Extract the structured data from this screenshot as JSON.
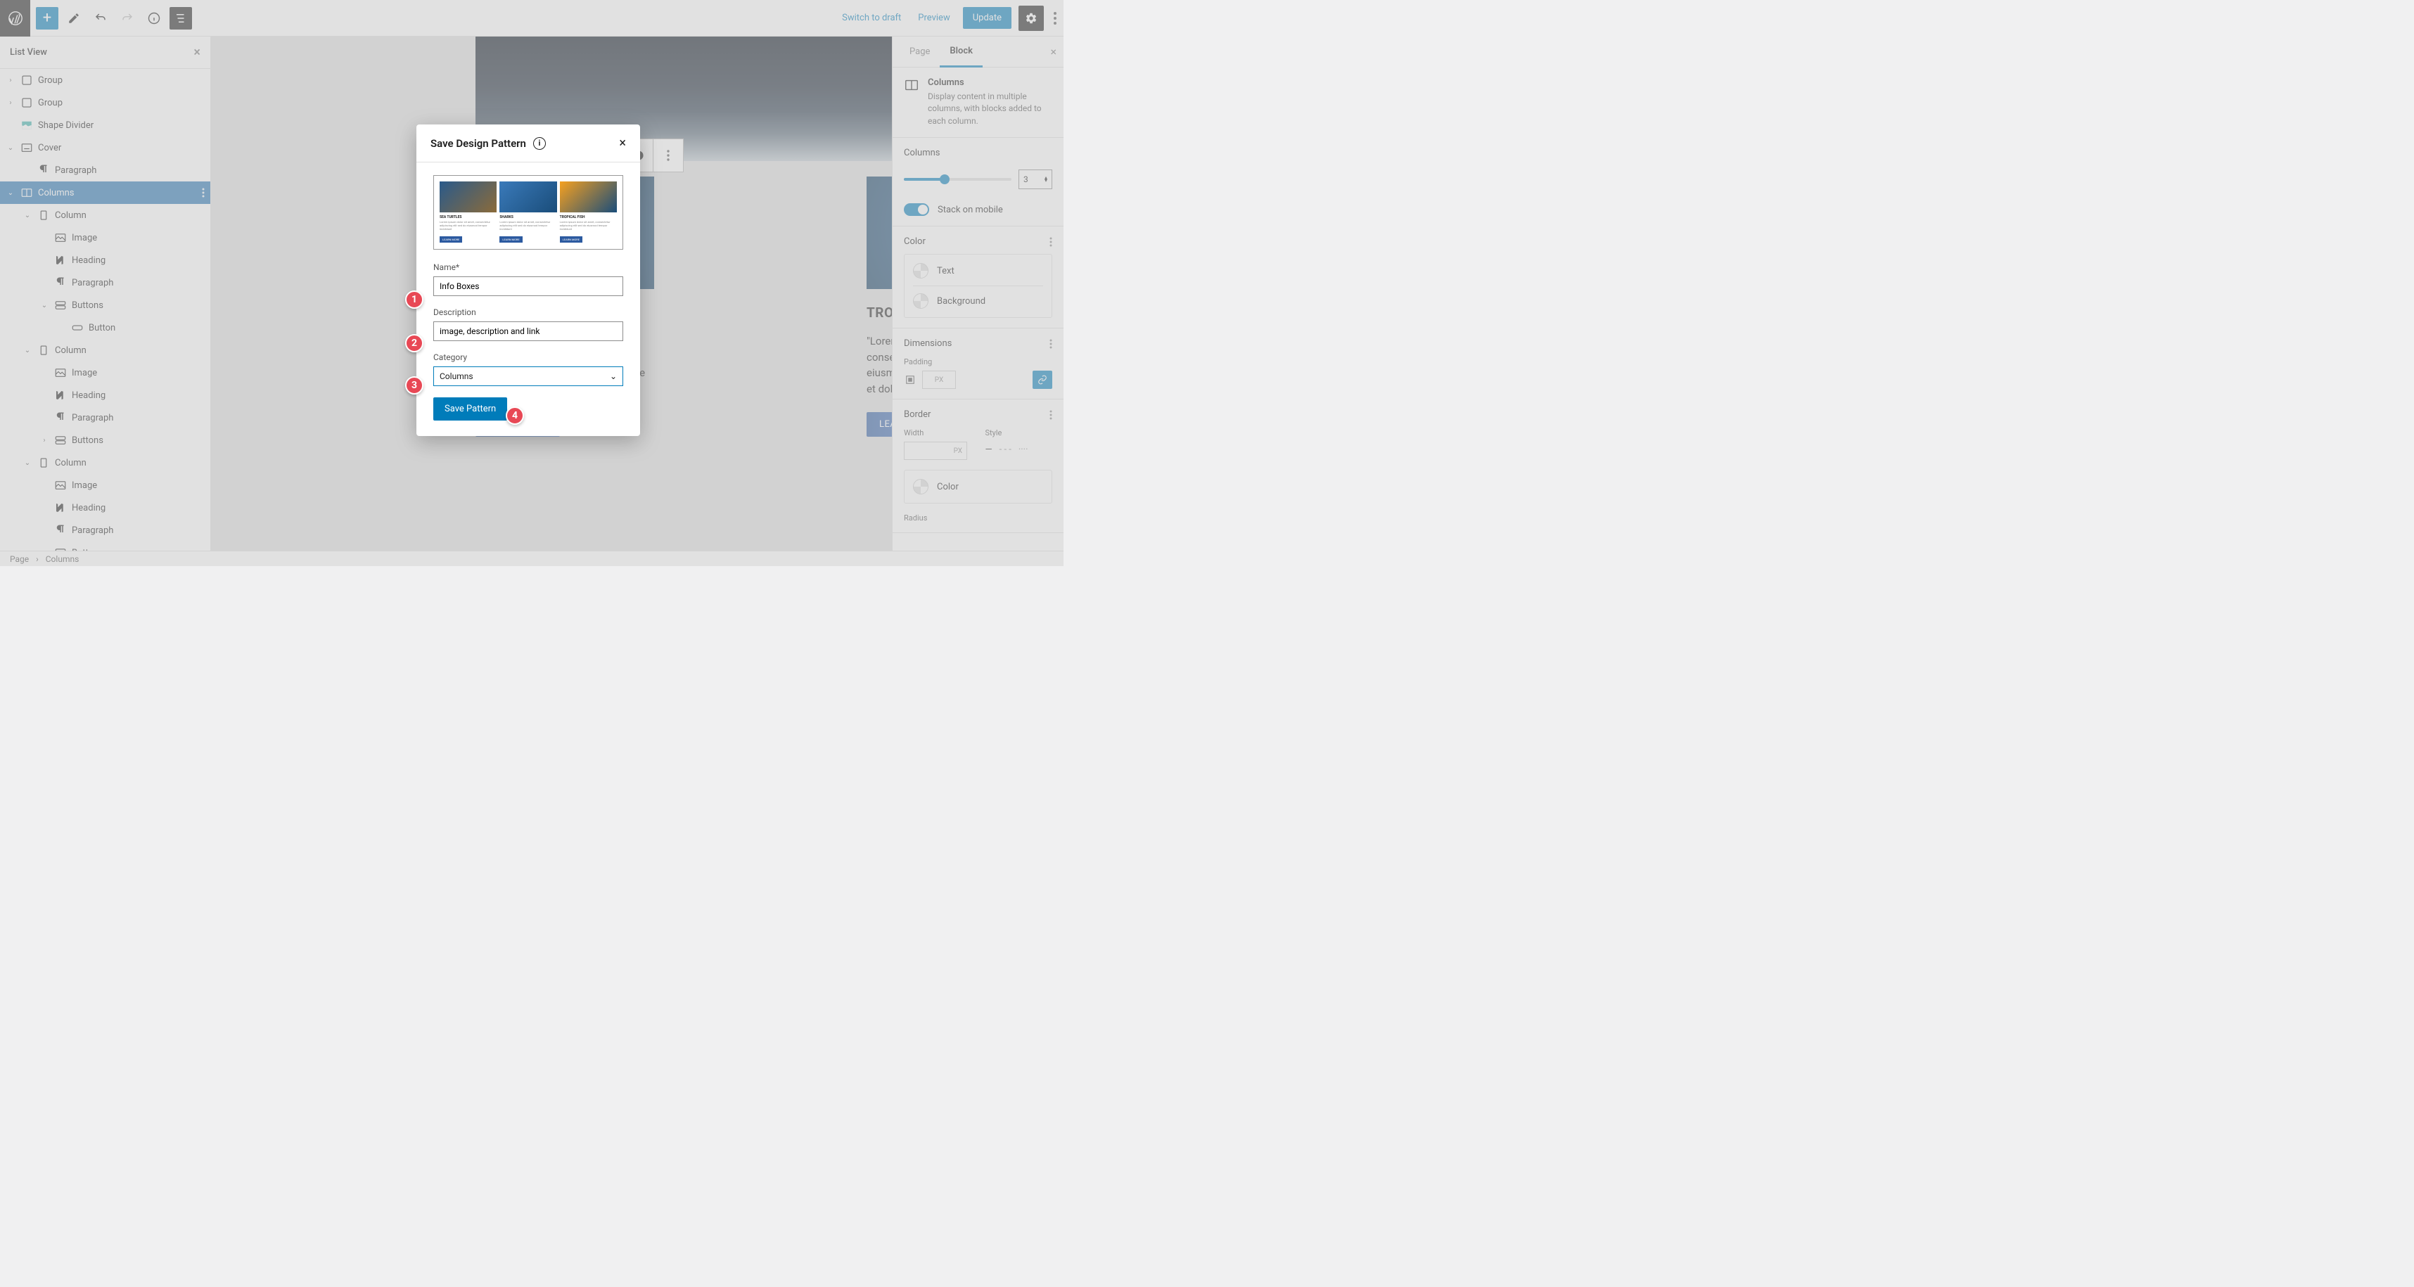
{
  "topbar": {
    "switch_to_draft": "Switch to draft",
    "preview": "Preview",
    "update": "Update"
  },
  "listview": {
    "title": "List View",
    "items": [
      {
        "indent": 0,
        "chev": "›",
        "icon": "group",
        "label": "Group"
      },
      {
        "indent": 0,
        "chev": "›",
        "icon": "group",
        "label": "Group"
      },
      {
        "indent": 0,
        "chev": "",
        "icon": "shape",
        "label": "Shape Divider"
      },
      {
        "indent": 0,
        "chev": "⌄",
        "icon": "cover",
        "label": "Cover"
      },
      {
        "indent": 1,
        "chev": "",
        "icon": "para",
        "label": "Paragraph"
      },
      {
        "indent": 0,
        "chev": "⌄",
        "icon": "columns",
        "label": "Columns",
        "selected": true
      },
      {
        "indent": 1,
        "chev": "⌄",
        "icon": "column",
        "label": "Column"
      },
      {
        "indent": 2,
        "chev": "",
        "icon": "image",
        "label": "Image"
      },
      {
        "indent": 2,
        "chev": "",
        "icon": "heading",
        "label": "Heading"
      },
      {
        "indent": 2,
        "chev": "",
        "icon": "para",
        "label": "Paragraph"
      },
      {
        "indent": 2,
        "chev": "⌄",
        "icon": "buttons",
        "label": "Buttons"
      },
      {
        "indent": 3,
        "chev": "",
        "icon": "button",
        "label": "Button"
      },
      {
        "indent": 1,
        "chev": "⌄",
        "icon": "column",
        "label": "Column"
      },
      {
        "indent": 2,
        "chev": "",
        "icon": "image",
        "label": "Image"
      },
      {
        "indent": 2,
        "chev": "",
        "icon": "heading",
        "label": "Heading"
      },
      {
        "indent": 2,
        "chev": "",
        "icon": "para",
        "label": "Paragraph"
      },
      {
        "indent": 2,
        "chev": "›",
        "icon": "buttons",
        "label": "Buttons"
      },
      {
        "indent": 1,
        "chev": "⌄",
        "icon": "column",
        "label": "Column"
      },
      {
        "indent": 2,
        "chev": "",
        "icon": "image",
        "label": "Image"
      },
      {
        "indent": 2,
        "chev": "",
        "icon": "heading",
        "label": "Heading"
      },
      {
        "indent": 2,
        "chev": "",
        "icon": "para",
        "label": "Paragraph"
      },
      {
        "indent": 2,
        "chev": "›",
        "icon": "buttons",
        "label": "Buttons"
      }
    ]
  },
  "cards": {
    "c1": {
      "title": "SEA TURTLES",
      "text": "\"Lorem ipsum dolor sit amet, consectetur adipiscing elit, sed do eiusmod tempor incididunt ut labore et dolore magna aliqua.",
      "btn": "LEARN MORE"
    },
    "c3": {
      "title": "TROPICAL FISH",
      "text": "\"Lorem ipsum dolor sit amet, consectetur adipiscing elit, sed do eiusmod tempor incididunt ut labore et dolore magna aliqua.",
      "btn": "LEARN MORE"
    }
  },
  "inspector": {
    "tab_page": "Page",
    "tab_block": "Block",
    "block_name": "Columns",
    "block_desc": "Display content in multiple columns, with blocks added to each column.",
    "columns_label": "Columns",
    "columns_value": "3",
    "stack_label": "Stack on mobile",
    "color_hdr": "Color",
    "color_text": "Text",
    "color_bg": "Background",
    "dim_hdr": "Dimensions",
    "padding": "Padding",
    "px": "PX",
    "border_hdr": "Border",
    "width": "Width",
    "style": "Style",
    "color": "Color",
    "radius": "Radius"
  },
  "modal": {
    "title": "Save Design Pattern",
    "name_label": "Name*",
    "name_value": "Info Boxes",
    "desc_label": "Description",
    "desc_value": "image, description and link",
    "cat_label": "Category",
    "cat_value": "Columns",
    "save": "Save Pattern",
    "preview": {
      "t1": "SEA TURTLES",
      "t2": "SHARKS",
      "t3": "TROPICAL FISH",
      "desc": "Lorem ipsum dolor sit amet, consectetur adipiscing elit sed do eiusmod tempor incididunt",
      "btn": "LEARN MORE"
    }
  },
  "footer": {
    "crumb1": "Page",
    "crumb2": "Columns"
  },
  "callouts": {
    "c1": "1",
    "c2": "2",
    "c3": "3",
    "c4": "4"
  }
}
